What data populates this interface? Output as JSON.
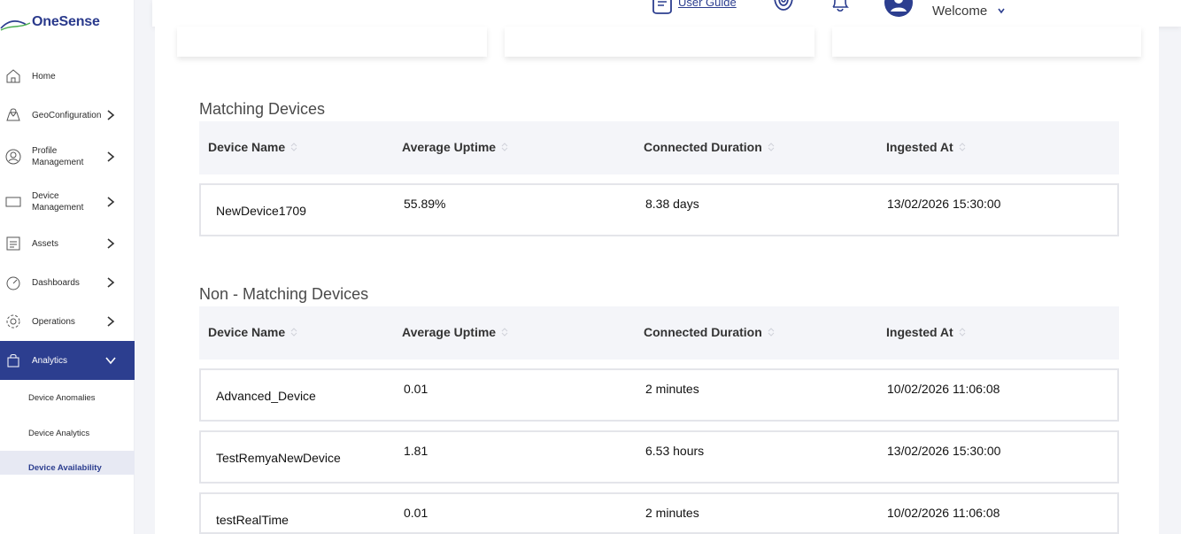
{
  "brand": {
    "name": "OneSense",
    "accent": "#2c3e8f"
  },
  "sidebar": {
    "items": [
      {
        "label": "Home",
        "icon": "home-icon",
        "has_chevron": false
      },
      {
        "label": "GeoConfiguration",
        "icon": "map-icon",
        "has_chevron": true
      },
      {
        "label": "Profile Management",
        "icon": "user-circle-icon",
        "has_chevron": true
      },
      {
        "label": "Device Management",
        "icon": "device-icon",
        "has_chevron": true
      },
      {
        "label": "Assets",
        "icon": "assets-icon",
        "has_chevron": true
      },
      {
        "label": "Dashboards",
        "icon": "gauge-icon",
        "has_chevron": true
      },
      {
        "label": "Operations",
        "icon": "gear-icon",
        "has_chevron": true
      },
      {
        "label": "Analytics",
        "icon": "bag-icon",
        "has_chevron": true,
        "expanded": true,
        "active": true
      }
    ],
    "subitems": [
      {
        "label": "Device Anomalies"
      },
      {
        "label": "Device Analytics"
      },
      {
        "label": "Device Availability",
        "active": true
      }
    ]
  },
  "header": {
    "user_guide": "User Guide",
    "welcome": "Welcome"
  },
  "matching": {
    "title": "Matching Devices",
    "columns": [
      "Device Name",
      "Average Uptime",
      "Connected Duration",
      "Ingested At"
    ],
    "rows": [
      {
        "name": "NewDevice1709",
        "uptime": "55.89%",
        "duration": "8.38 days",
        "ingested": "13/02/2026 15:30:00"
      }
    ]
  },
  "non_matching": {
    "title": "Non - Matching Devices",
    "columns": [
      "Device Name",
      "Average Uptime",
      "Connected Duration",
      "Ingested At"
    ],
    "rows": [
      {
        "name": "Advanced_Device",
        "uptime": "0.01",
        "duration": "2 minutes",
        "ingested": "10/02/2026 11:06:08"
      },
      {
        "name": "TestRemyaNewDevice",
        "uptime": "1.81",
        "duration": "6.53 hours",
        "ingested": "13/02/2026 15:30:00"
      },
      {
        "name": "testRealTime",
        "uptime": "0.01",
        "duration": "2 minutes",
        "ingested": "10/02/2026 11:06:08"
      }
    ]
  }
}
